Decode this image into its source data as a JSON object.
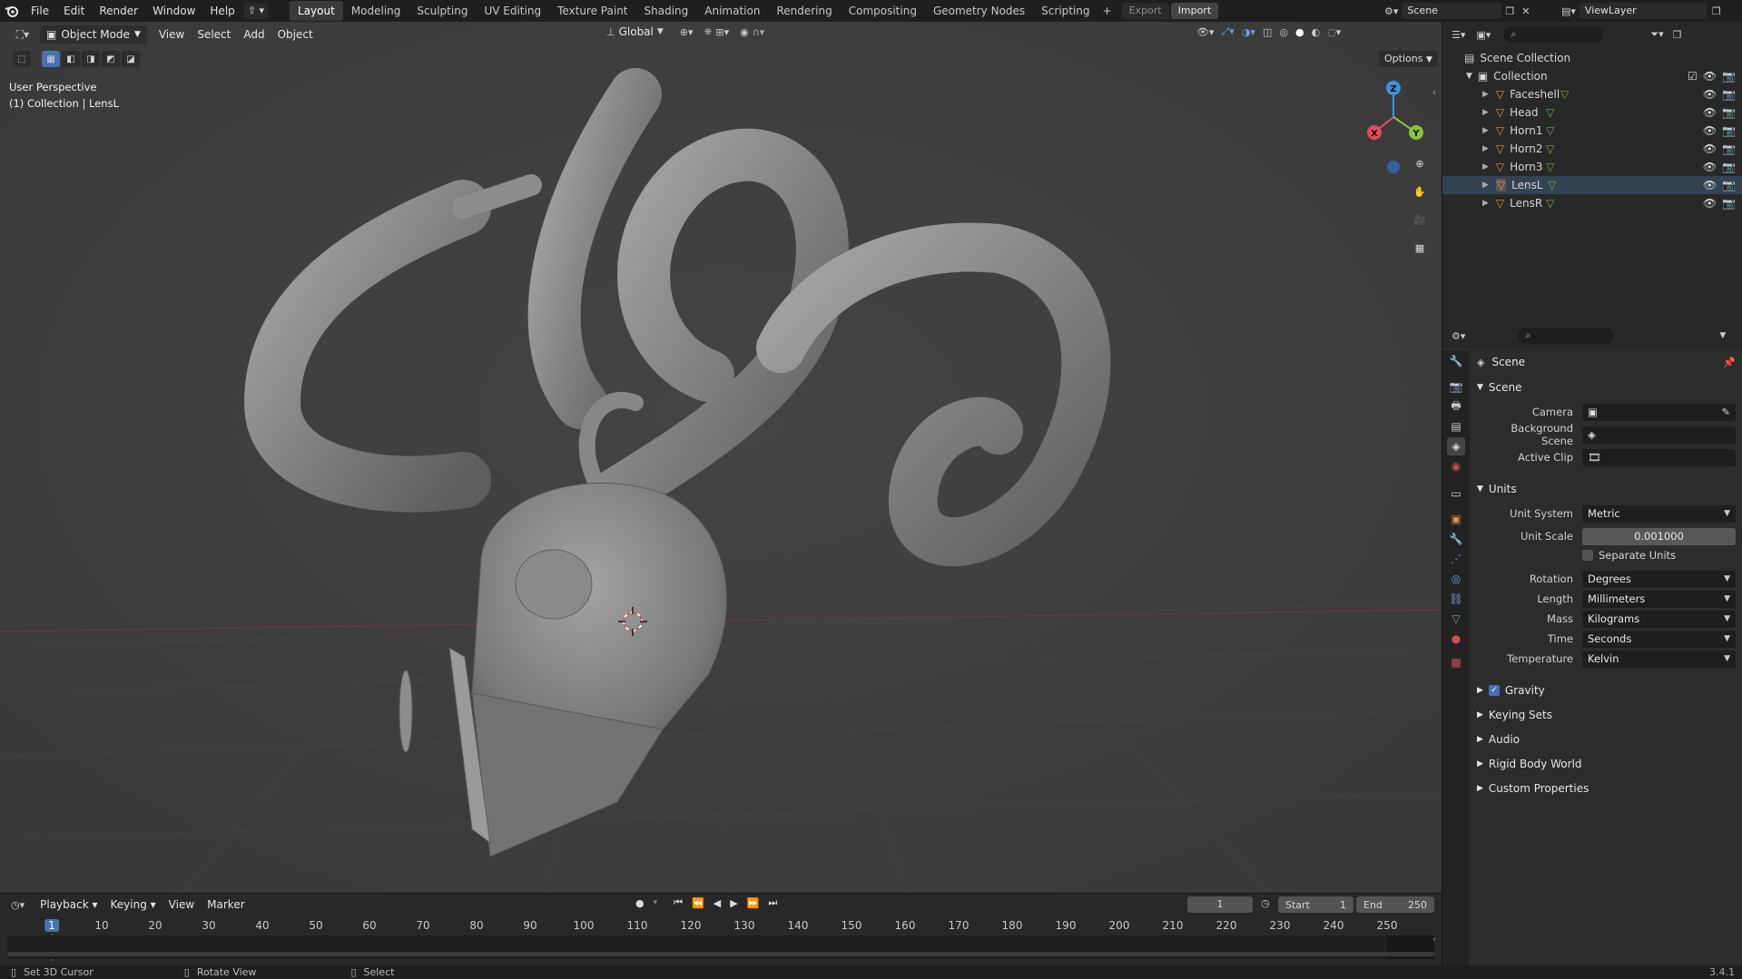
{
  "topbar": {
    "menus": [
      "File",
      "Edit",
      "Render",
      "Window",
      "Help"
    ],
    "workspaces": [
      "Layout",
      "Modeling",
      "Sculpting",
      "UV Editing",
      "Texture Paint",
      "Shading",
      "Animation",
      "Rendering",
      "Compositing",
      "Geometry Nodes",
      "Scripting"
    ],
    "active_workspace": "Layout",
    "export_label": "Export",
    "import_label": "Import",
    "scene_name": "Scene",
    "view_layer": "ViewLayer"
  },
  "viewport": {
    "mode": "Object Mode",
    "menus": [
      "View",
      "Select",
      "Add",
      "Object"
    ],
    "orientation": "Global",
    "options_label": "Options",
    "overlay_line1": "User Perspective",
    "overlay_line2": "(1) Collection | LensL",
    "gizmo": {
      "z": "Z",
      "x": "X",
      "y": "Y"
    }
  },
  "outliner": {
    "root": "Scene Collection",
    "collection": "Collection",
    "objects": [
      "Faceshell",
      "Head",
      "Horn1",
      "Horn2",
      "Horn3",
      "LensL",
      "LensR"
    ],
    "selected": "LensL"
  },
  "properties": {
    "context": "Scene",
    "scene_panel": {
      "title": "Scene",
      "camera_label": "Camera",
      "background_scene_label": "Background Scene",
      "active_clip_label": "Active Clip"
    },
    "units_panel": {
      "title": "Units",
      "unit_system_label": "Unit System",
      "unit_system": "Metric",
      "unit_scale_label": "Unit Scale",
      "unit_scale": "0.001000",
      "separate_units": "Separate Units",
      "rotation_label": "Rotation",
      "rotation": "Degrees",
      "length_label": "Length",
      "length": "Millimeters",
      "mass_label": "Mass",
      "mass": "Kilograms",
      "time_label": "Time",
      "time": "Seconds",
      "temperature_label": "Temperature",
      "temperature": "Kelvin"
    },
    "collapsed_panels": [
      "Gravity",
      "Keying Sets",
      "Audio",
      "Rigid Body World",
      "Custom Properties"
    ]
  },
  "timeline": {
    "menus": [
      "Playback",
      "Keying",
      "View",
      "Marker"
    ],
    "current_frame": "1",
    "start_label": "Start",
    "start": "1",
    "end_label": "End",
    "end": "250",
    "ticks": [
      "1",
      "10",
      "20",
      "30",
      "40",
      "50",
      "60",
      "70",
      "80",
      "90",
      "100",
      "110",
      "120",
      "130",
      "140",
      "150",
      "160",
      "170",
      "180",
      "190",
      "200",
      "210",
      "220",
      "230",
      "240",
      "250"
    ]
  },
  "statusbar": {
    "left_hint": "Set 3D Cursor",
    "middle_hint": "Rotate View",
    "right_hint": "Select",
    "version": "3.4.1"
  },
  "colors": {
    "accent": "#4772b3",
    "object_orange": "#e8913a",
    "mesh_green": "#69b04a",
    "axis_x": "#e84a5f",
    "axis_y": "#8cc43f",
    "axis_z": "#3f8fe0"
  }
}
